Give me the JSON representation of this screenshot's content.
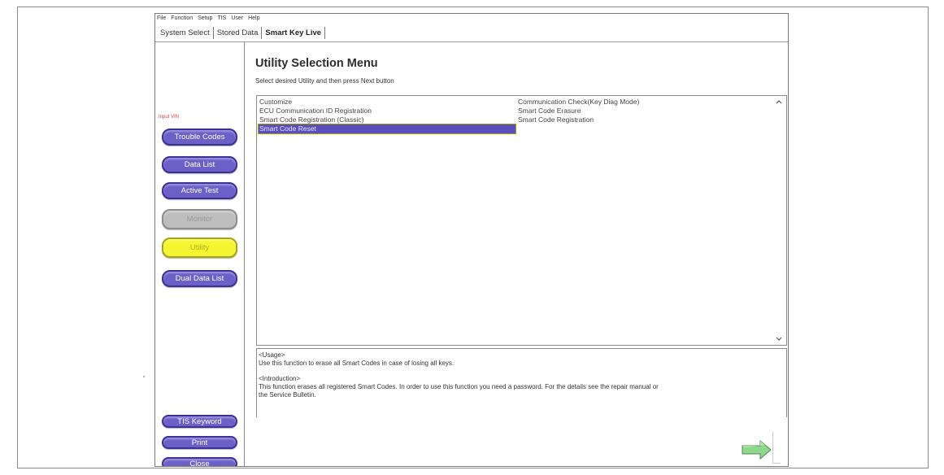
{
  "menubar": [
    "File",
    "Function",
    "Setup",
    "TIS",
    "User",
    "Help"
  ],
  "tabs": [
    {
      "label": "System Select",
      "active": false
    },
    {
      "label": "Stored Data",
      "active": false
    },
    {
      "label": "Smart Key Live",
      "active": true
    }
  ],
  "sidebar": {
    "input_vin": "Input VIN",
    "buttons": {
      "trouble_codes": "Trouble Codes",
      "data_list": "Data List",
      "active_test": "Active Test",
      "monitor": "Monitor",
      "utility": "Utility",
      "dual_data_list": "Dual Data List",
      "tis_keyword": "TIS Keyword",
      "print": "Print",
      "close": "Close"
    }
  },
  "main": {
    "title": "Utility Selection Menu",
    "subtitle": "Select desired Utility and then press Next button",
    "list_left": [
      "Customize",
      "ECU Communication ID Registration",
      "Smart Code Registration (Classic)",
      "Smart Code Reset"
    ],
    "list_right": [
      "Communication Check(Key Diag Mode)",
      "Smart Code Erasure",
      "Smart Code Registration"
    ],
    "selected_item": "Smart Code Reset",
    "description": {
      "usage_header": "<Usage>",
      "usage_text": "Use this function to erase all Smart Codes in case of losing all keys.",
      "intro_header": "<Introduction>",
      "intro_text_1": "This function erases all registered Smart Codes. In order to use this function you need a password. For the details see the repair manual or",
      "intro_text_2": "the Service Bulletin."
    }
  },
  "colors": {
    "button_purple": "#6b5fc8",
    "button_gray": "#bdbdbd",
    "button_yellow": "#f5f531",
    "selection": "#5a4fbd",
    "next_arrow": "#7ed07e"
  },
  "icons": {
    "scroll_up": "chevron-up-icon",
    "scroll_down": "chevron-down-icon",
    "next": "next-arrow-icon"
  }
}
